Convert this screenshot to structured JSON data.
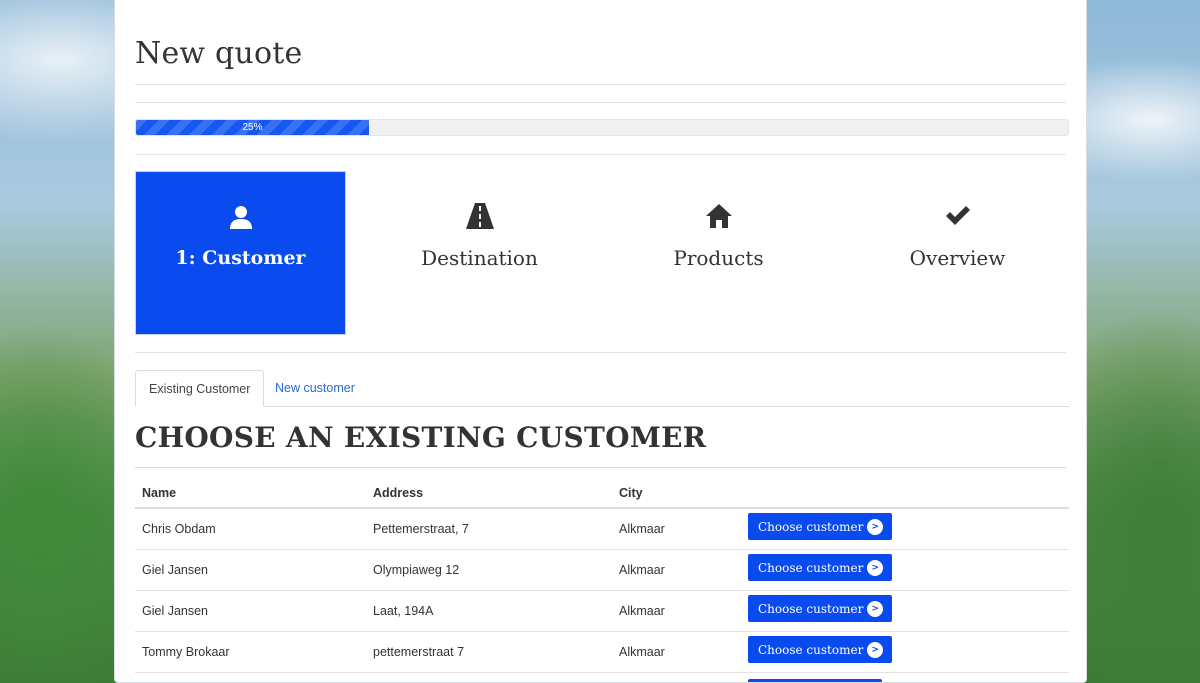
{
  "page": {
    "title": "New quote"
  },
  "progress": {
    "value": 25,
    "label": "25%",
    "color": "#1558f0"
  },
  "steps": [
    {
      "label": "1: Customer",
      "icon": "user-icon",
      "active": true
    },
    {
      "label": "Destination",
      "icon": "road-icon",
      "active": false
    },
    {
      "label": "Products",
      "icon": "home-icon",
      "active": false
    },
    {
      "label": "Overview",
      "icon": "checkmark-icon",
      "active": false
    }
  ],
  "tabs": [
    {
      "label": "Existing Customer",
      "active": true
    },
    {
      "label": "New customer",
      "active": false
    }
  ],
  "section": {
    "title": "CHOOSE AN EXISTING CUSTOMER"
  },
  "table": {
    "headers": [
      "Name",
      "Address",
      "City"
    ],
    "rows": [
      {
        "name": "Chris Obdam",
        "address": "Pettemerstraat, 7",
        "city": "Alkmaar",
        "action": "Choose customer"
      },
      {
        "name": "Giel Jansen",
        "address": "Olympiaweg 12",
        "city": "Alkmaar",
        "action": "Choose customer"
      },
      {
        "name": "Giel Jansen",
        "address": "Laat, 194A",
        "city": "Alkmaar",
        "action": "Choose customer"
      },
      {
        "name": "Tommy Brokaar",
        "address": "pettemerstraat 7",
        "city": "Alkmaar",
        "action": "Choose customer"
      }
    ],
    "button_arrow": ">"
  },
  "colors": {
    "accent": "#0a4bf0",
    "link": "#2a6ad2"
  }
}
